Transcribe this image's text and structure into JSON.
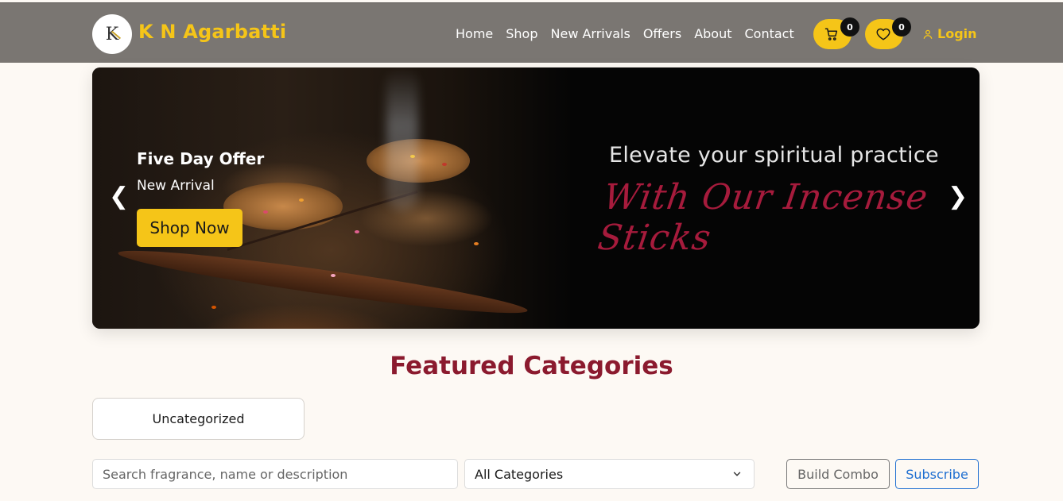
{
  "brand": {
    "name": "K N Agarbatti",
    "logo_letter": "K",
    "icon": "agarbatti-logo-icon"
  },
  "nav": {
    "links": [
      "Home",
      "Shop",
      "New Arrivals",
      "Offers",
      "About",
      "Contact"
    ],
    "cart_count": "0",
    "wishlist_count": "0",
    "login_label": "Login"
  },
  "hero": {
    "offer_title": "Five Day Offer",
    "offer_subtitle": "New Arrival",
    "cta_label": "Shop Now",
    "headline": "Elevate your spiritual practice",
    "script_text": "With Our Incense Sticks",
    "prev_arrow": "❮",
    "next_arrow": "❯"
  },
  "featured": {
    "title": "Featured Categories",
    "categories": [
      "Uncategorized"
    ]
  },
  "filters": {
    "search_placeholder": "Search fragrance, name or description",
    "category_selected": "All Categories",
    "build_combo_label": "Build Combo",
    "subscribe_label": "Subscribe"
  },
  "colors": {
    "nav_bg": "#7a7672",
    "accent_yellow": "#f5c518",
    "heading_maroon": "#8b1a2e",
    "script_red": "#a61b3c",
    "subscribe_blue": "#1f6fd1"
  }
}
